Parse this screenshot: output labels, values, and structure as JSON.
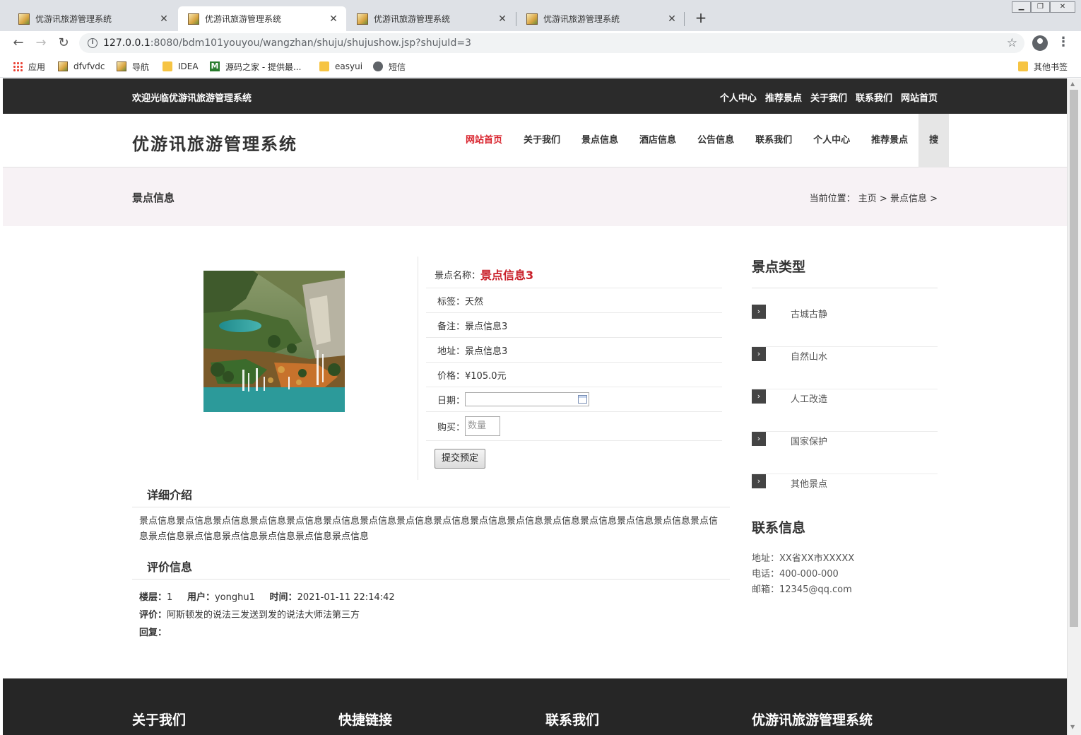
{
  "browser": {
    "tabs": [
      {
        "title": "优游讯旅游管理系统",
        "active": false
      },
      {
        "title": "优游讯旅游管理系统",
        "active": true
      },
      {
        "title": "优游讯旅游管理系统",
        "active": false
      },
      {
        "title": "优游讯旅游管理系统",
        "active": false
      }
    ],
    "url_host": "127.0.0.1",
    "url_path": ":8080/bdm101youyou/wangzhan/shuju/shujushow.jsp?shujuId=3",
    "bookmarks": [
      {
        "label": "应用",
        "icon": "apps-grid-icon"
      },
      {
        "label": "dfvfvdc",
        "icon": "site-favicon"
      },
      {
        "label": "导航",
        "icon": "site-favicon"
      },
      {
        "label": "IDEA",
        "icon": "folder-icon"
      },
      {
        "label": "源码之家 - 提供最...",
        "icon": "m-logo-icon"
      },
      {
        "label": "easyui",
        "icon": "folder-icon"
      },
      {
        "label": "短信",
        "icon": "globe-icon"
      }
    ],
    "other_bookmarks": "其他书签"
  },
  "topbar": {
    "welcome": "欢迎光临优游讯旅游管理系统",
    "links": [
      "个人中心",
      "推荐景点",
      "关于我们",
      "联系我们",
      "网站首页"
    ]
  },
  "nav": {
    "site_title": "优游讯旅游管理系统",
    "items": [
      "网站首页",
      "关于我们",
      "景点信息",
      "酒店信息",
      "公告信息",
      "联系我们",
      "个人中心",
      "推荐景点"
    ],
    "search_label": "搜"
  },
  "crumb": {
    "title": "景点信息",
    "path": "当前位置： 主页 > 景点信息 >"
  },
  "detail": {
    "name_label": "景点名称：",
    "name_value": "景点信息3",
    "tag": "标签：天然",
    "remark": "备注：景点信息3",
    "address": "地址：景点信息3",
    "price": "价格：¥105.0元",
    "date_label": "日期：",
    "buy_label": "购买：",
    "qty_placeholder": "数量",
    "submit": "提交预定"
  },
  "intro": {
    "heading": "详细介绍",
    "text": "景点信息景点信息景点信息景点信息景点信息景点信息景点信息景点信息景点信息景点信息景点信息景点信息景点信息景点信息景点信息景点信息景点信息景点信息景点信息景点信息景点信息景点信息"
  },
  "reviews": {
    "heading": "评价信息",
    "floor_label": "楼层：",
    "floor": "1",
    "user_label": "用户：",
    "user": "yonghu1",
    "time_label": "时间：",
    "time": "2021-01-11 22:14:42",
    "comment_label": "评价：",
    "comment": "阿斯顿发的说法三发送到发的说法大师法第三方",
    "reply_label": "回复："
  },
  "sidebar": {
    "categories_heading": "景点类型",
    "categories": [
      "古城古静",
      "自然山水",
      "人工改造",
      "国家保护",
      "其他景点"
    ],
    "contact_heading": "联系信息",
    "contact": [
      "地址：XX省XX市XXXXX",
      "电话：400-000-000",
      "邮箱：12345@qq.com"
    ]
  },
  "footer": {
    "headings": [
      "关于我们",
      "快捷链接",
      "联系我们",
      "优游讯旅游管理系统"
    ]
  }
}
